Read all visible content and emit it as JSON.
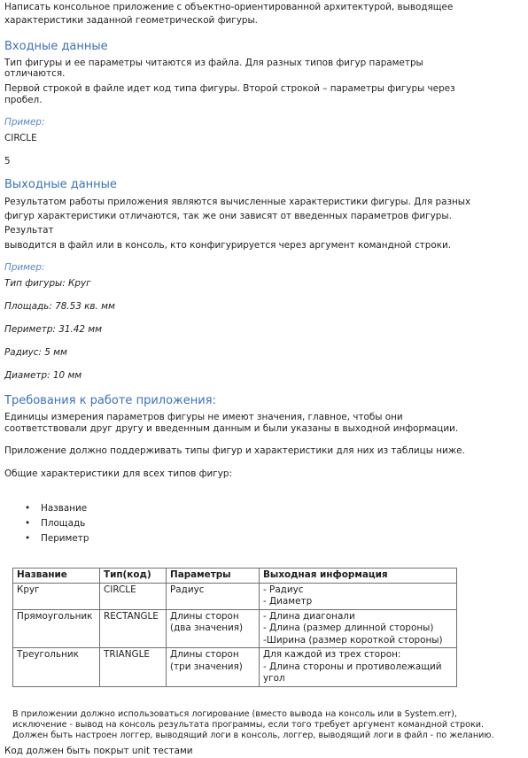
{
  "intro": {
    "line1": "Написать консольное приложение с объектно-ориентированной архитектурой, выводящее",
    "line2": "характеристики заданной геометрической фигуры."
  },
  "input": {
    "heading": "Входные данные",
    "p1_line1": "Тип фигуры и ее параметры читаются из файла. Для разных типов фигур параметры",
    "p1_line2": "отличаются.",
    "p2_line1": "Первой строкой в файле идет код типа фигуры. Второй строкой – параметры фигуры через",
    "p2_line2": "пробел.",
    "example_label": "Пример:",
    "example_line1": "CIRCLE",
    "example_line2": "5"
  },
  "output": {
    "heading": "Выходные данные",
    "line1": "Результатом работы приложения являются вычисленные характеристики фигуры. Для разных",
    "line2": "фигур характеристики отличаются, так же они зависят от введенных параметров фигуры.",
    "line3": "Результат",
    "line4": "выводится в файл или в консоль, кто конфигурируется через аргумент командной строки.",
    "example_label": "Пример:",
    "example_lines": [
      "Тип фигуры: Круг",
      "Площадь: 78.53 кв. мм",
      "Периметр: 31.42 мм",
      "Радиус: 5 мм",
      "Диаметр: 10 мм"
    ]
  },
  "requirements": {
    "heading": "Требования к работе приложения:",
    "line1": "Единицы измерения параметров фигуры не имеют значения, главное, чтобы они",
    "line2": "соответствовали друг другу и введенным данным и были указаны в выходной информации.",
    "line3": "Приложение должно поддерживать типы фигур и характеристики для них из таблицы ниже.",
    "line4": "Общие характеристики для всех типов фигур:",
    "bullet_glyph": "•",
    "bullets": [
      "Название",
      "Площадь",
      "Периметр"
    ]
  },
  "table": {
    "headers": [
      "Название",
      "Тип(код)",
      "Параметры",
      "Выходная информация"
    ],
    "rows": [
      {
        "name": "Круг",
        "code": "CIRCLE",
        "params": [
          "Радиус"
        ],
        "output": [
          "- Радиус",
          "- Диаметр"
        ]
      },
      {
        "name": "Прямоугольник",
        "code": "RECTANGLE",
        "params": [
          "Длины сторон",
          "(два значения)"
        ],
        "output": [
          "- Длина диагонали",
          "- Длина (размер длинной стороны)",
          "-Ширина (размер короткой стороны)"
        ]
      },
      {
        "name": "Треугольник",
        "code": "TRIANGLE",
        "params": [
          "Длины сторон",
          "(три значения)"
        ],
        "output": [
          "Для каждой из трех сторон:",
          "- Длина стороны и противолежащий",
          "угол"
        ]
      }
    ]
  },
  "footer": {
    "log_line1": "В приложении должно использоваться логирование (вместо вывода на консоль или в System.err),",
    "log_line2": "исключение - вывод на консоль результата программы, если того требует аргумент командной строки.",
    "log_line3": "Должен быть настроен логгер, выводящий логи в консоль, логгер, выводящий логи в файл - по желанию.",
    "tests": "Код должен быть покрыт unit тестами"
  }
}
